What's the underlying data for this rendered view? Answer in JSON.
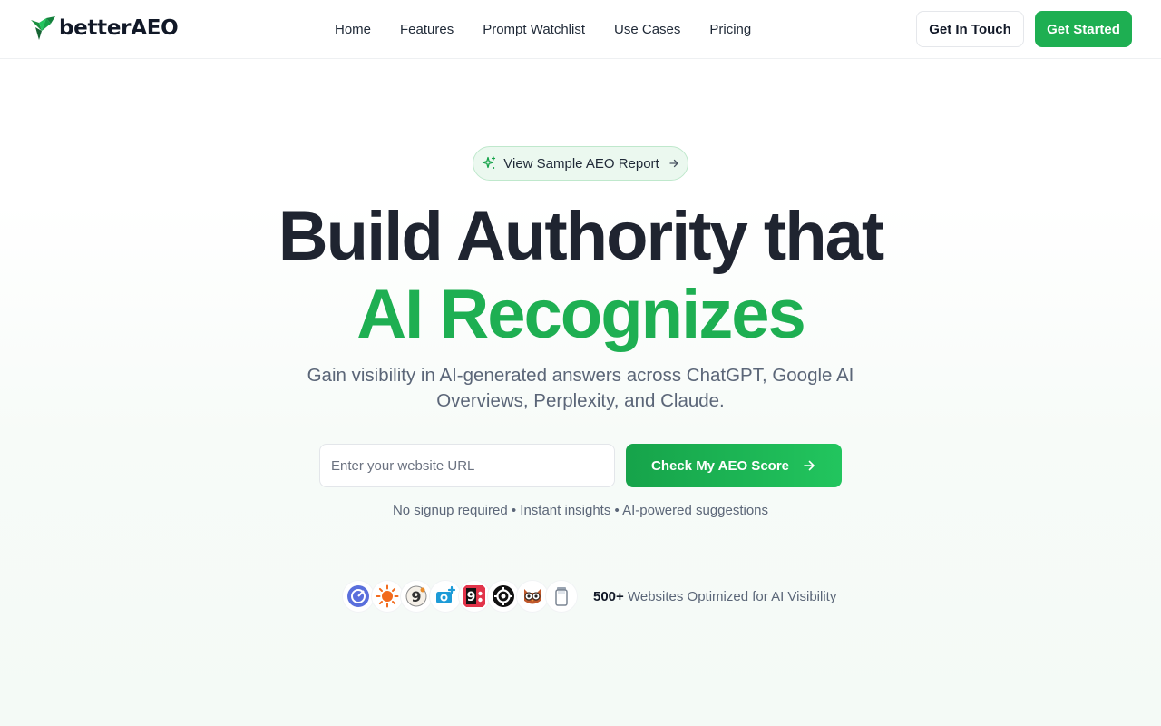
{
  "brand": {
    "name": "betterAEO",
    "accent": "#1eaf52"
  },
  "nav": {
    "items": [
      {
        "label": "Home"
      },
      {
        "label": "Features"
      },
      {
        "label": "Prompt Watchlist"
      },
      {
        "label": "Use Cases"
      },
      {
        "label": "Pricing"
      }
    ]
  },
  "header": {
    "contact_label": "Get In Touch",
    "start_label": "Get Started"
  },
  "hero": {
    "badge_label": "View Sample AEO Report",
    "title_line1": "Build Authority that",
    "title_line2": "AI Recognizes",
    "subtitle": "Gain visibility in AI-generated answers across ChatGPT, Google AI Overviews, Perplexity, and Claude.",
    "url_placeholder": "Enter your website URL",
    "url_value": "",
    "cta_label": "Check My AEO Score",
    "hint": "No signup required • Instant insights • AI-powered suggestions"
  },
  "proof": {
    "count": "500+",
    "text": " Websites Optimized for AI Visibility",
    "avatars": [
      "blue-circle-logo-icon",
      "orange-sun-logo-icon",
      "number-nine-logo-icon",
      "camera-plus-logo-icon",
      "red-9-logo-icon",
      "black-gear-logo-icon",
      "owl-logo-icon",
      "jar-logo-icon"
    ]
  }
}
